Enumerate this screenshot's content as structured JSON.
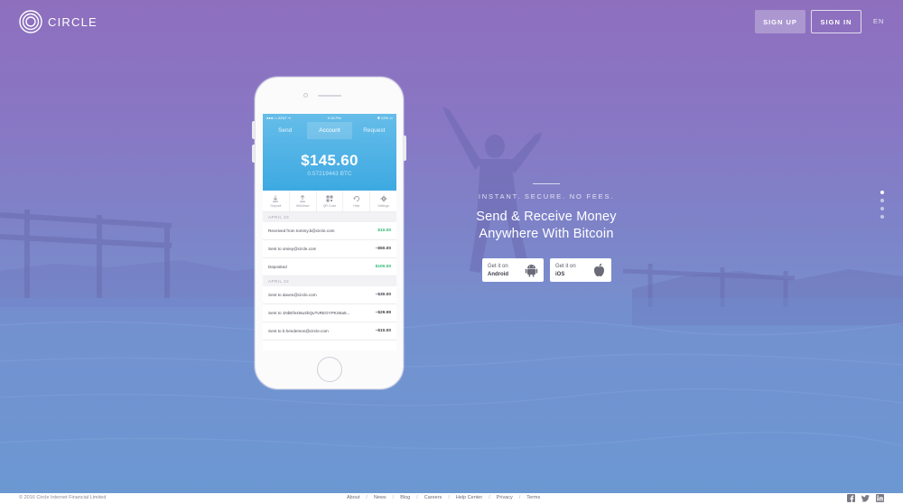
{
  "header": {
    "brand": "CIRCLE",
    "signup_label": "SIGN UP",
    "signin_label": "SIGN IN",
    "language": "EN"
  },
  "phone": {
    "status": {
      "carrier": "●●●○○ AT&T ᯤ",
      "time": "9:15 PM",
      "battery": "✱ 22% ▭"
    },
    "tabs": [
      {
        "label": "Send"
      },
      {
        "label": "Account",
        "active": true
      },
      {
        "label": "Request"
      }
    ],
    "balance": "$145.60",
    "btc_balance": "0.57219443 BTC",
    "actions": [
      {
        "label": "Deposit",
        "icon": "deposit-icon"
      },
      {
        "label": "Withdraw",
        "icon": "withdraw-icon"
      },
      {
        "label": "QR Code",
        "icon": "qr-code-icon"
      },
      {
        "label": "Help",
        "icon": "help-icon"
      },
      {
        "label": "Settings",
        "icon": "settings-icon"
      }
    ],
    "groups": [
      {
        "date": "APRIL 23",
        "transactions": [
          {
            "description": "Received from tommy.b@circle.com",
            "amount": "$10.00",
            "positive": true
          },
          {
            "description": "Sent to omiey@circle.com",
            "amount": "–$50.00",
            "positive": false
          },
          {
            "description": "Deposited",
            "amount": "$100.00",
            "positive": true
          }
        ]
      },
      {
        "date": "APRIL 22",
        "transactions": [
          {
            "description": "Sent to daven@circle.com",
            "amount": "–$30.00",
            "positive": false
          },
          {
            "description": "Sent to 1NbEfe4tswzbQuTvREGYPKS6a5...",
            "amount": "–$29.99",
            "positive": false
          },
          {
            "description": "Sent to b.henderson@circle.com",
            "amount": "–$10.00",
            "positive": false
          }
        ]
      }
    ]
  },
  "hero": {
    "tagline": "INSTANT. SECURE. NO FEES.",
    "headline_line1": "Send & Receive Money",
    "headline_line2": "Anywhere With Bitcoin",
    "stores": [
      {
        "small": "Get it on",
        "name": "Android",
        "icon": "android-icon"
      },
      {
        "small": "Get it on",
        "name": "iOS",
        "icon": "apple-icon"
      }
    ],
    "slides": 4,
    "active_slide": 0
  },
  "footer": {
    "copyright": "© 2016 Circle Internet Financial Limited",
    "links": [
      "About",
      "News",
      "Blog",
      "Careers",
      "Help Center",
      "Privacy",
      "Terms"
    ],
    "social": [
      "facebook-icon",
      "twitter-icon",
      "linkedin-icon"
    ]
  }
}
